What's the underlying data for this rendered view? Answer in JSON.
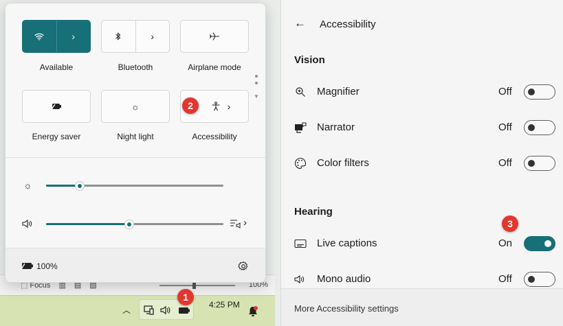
{
  "background": {
    "toolbar_focus": "Focus",
    "zoom_percent": "100%"
  },
  "quick_settings": {
    "tiles": [
      {
        "label": "Available",
        "icon": "wifi-icon",
        "active": true
      },
      {
        "label": "Bluetooth",
        "icon": "bluetooth-icon",
        "active": false
      },
      {
        "label": "Airplane mode",
        "icon": "airplane-icon",
        "active": false
      },
      {
        "label": "Energy saver",
        "icon": "energy-saver-icon",
        "active": false
      },
      {
        "label": "Night light",
        "icon": "night-light-icon",
        "active": false
      },
      {
        "label": "Accessibility",
        "icon": "accessibility-icon",
        "active": false
      }
    ],
    "brightness_level": 0.19,
    "volume_level": 0.47,
    "battery_percent": "100%"
  },
  "taskbar": {
    "time": "4:25 PM"
  },
  "accessibility": {
    "title": "Accessibility",
    "vision_heading": "Vision",
    "hearing_heading": "Hearing",
    "rows": [
      {
        "label": "Magnifier",
        "state": "Off",
        "icon": "magnifier-icon"
      },
      {
        "label": "Narrator",
        "state": "Off",
        "icon": "narrator-icon"
      },
      {
        "label": "Color filters",
        "state": "Off",
        "icon": "color-filters-icon"
      },
      {
        "label": "Live captions",
        "state": "On",
        "icon": "live-captions-icon"
      },
      {
        "label": "Mono audio",
        "state": "Off",
        "icon": "mono-audio-icon"
      }
    ],
    "more_link": "More Accessibility settings"
  },
  "annotations": {
    "step1": "1",
    "step2": "2",
    "step3": "3"
  },
  "colors": {
    "accent": "#176f78",
    "badge": "#e2362f",
    "taskbar": "#d7e3b3"
  }
}
